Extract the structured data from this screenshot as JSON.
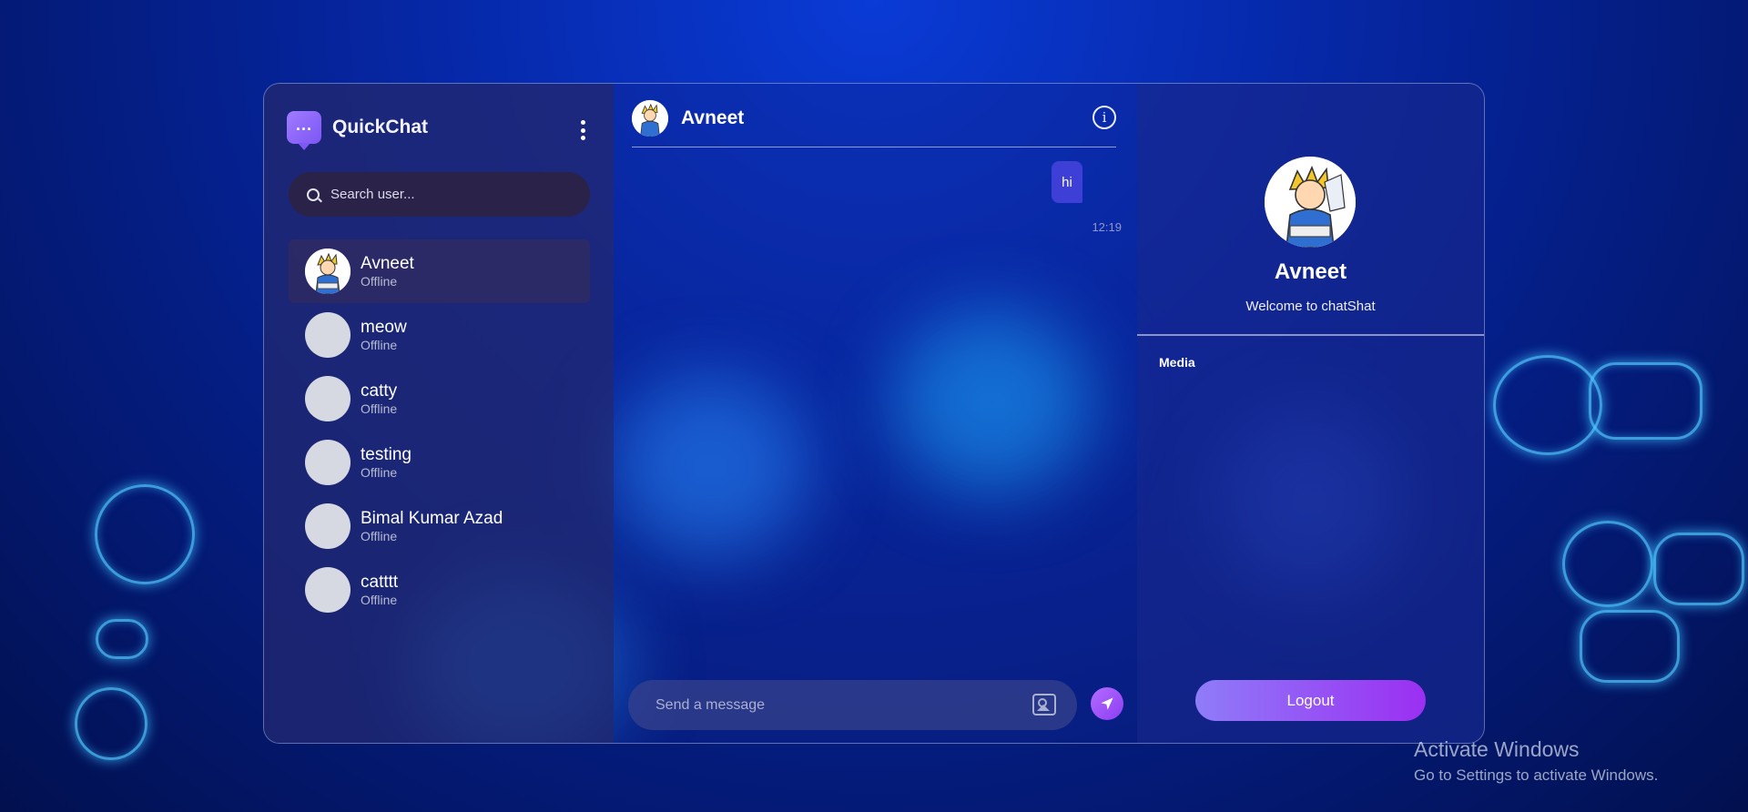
{
  "app": {
    "brand_name": "QuickChat",
    "accent_color": "#8c3df2"
  },
  "search": {
    "placeholder": "Search user..."
  },
  "users": [
    {
      "name": "Avneet",
      "status": "Offline",
      "active": true
    },
    {
      "name": "meow",
      "status": "Offline",
      "active": false
    },
    {
      "name": "catty",
      "status": "Offline",
      "active": false
    },
    {
      "name": "testing",
      "status": "Offline",
      "active": false
    },
    {
      "name": "Bimal Kumar Azad",
      "status": "Offline",
      "active": false
    },
    {
      "name": "catttt",
      "status": "Offline",
      "active": false
    }
  ],
  "chat": {
    "contact_name": "Avneet",
    "messages": [
      {
        "text": "hi",
        "time": "12:19",
        "own": true
      }
    ],
    "composer_placeholder": "Send a message"
  },
  "profile": {
    "name": "Avneet",
    "bio": "Welcome to chatShat",
    "media_label": "Media",
    "logout_label": "Logout"
  },
  "os_overlay": {
    "title": "Activate Windows",
    "subtitle": "Go to Settings to activate Windows."
  }
}
